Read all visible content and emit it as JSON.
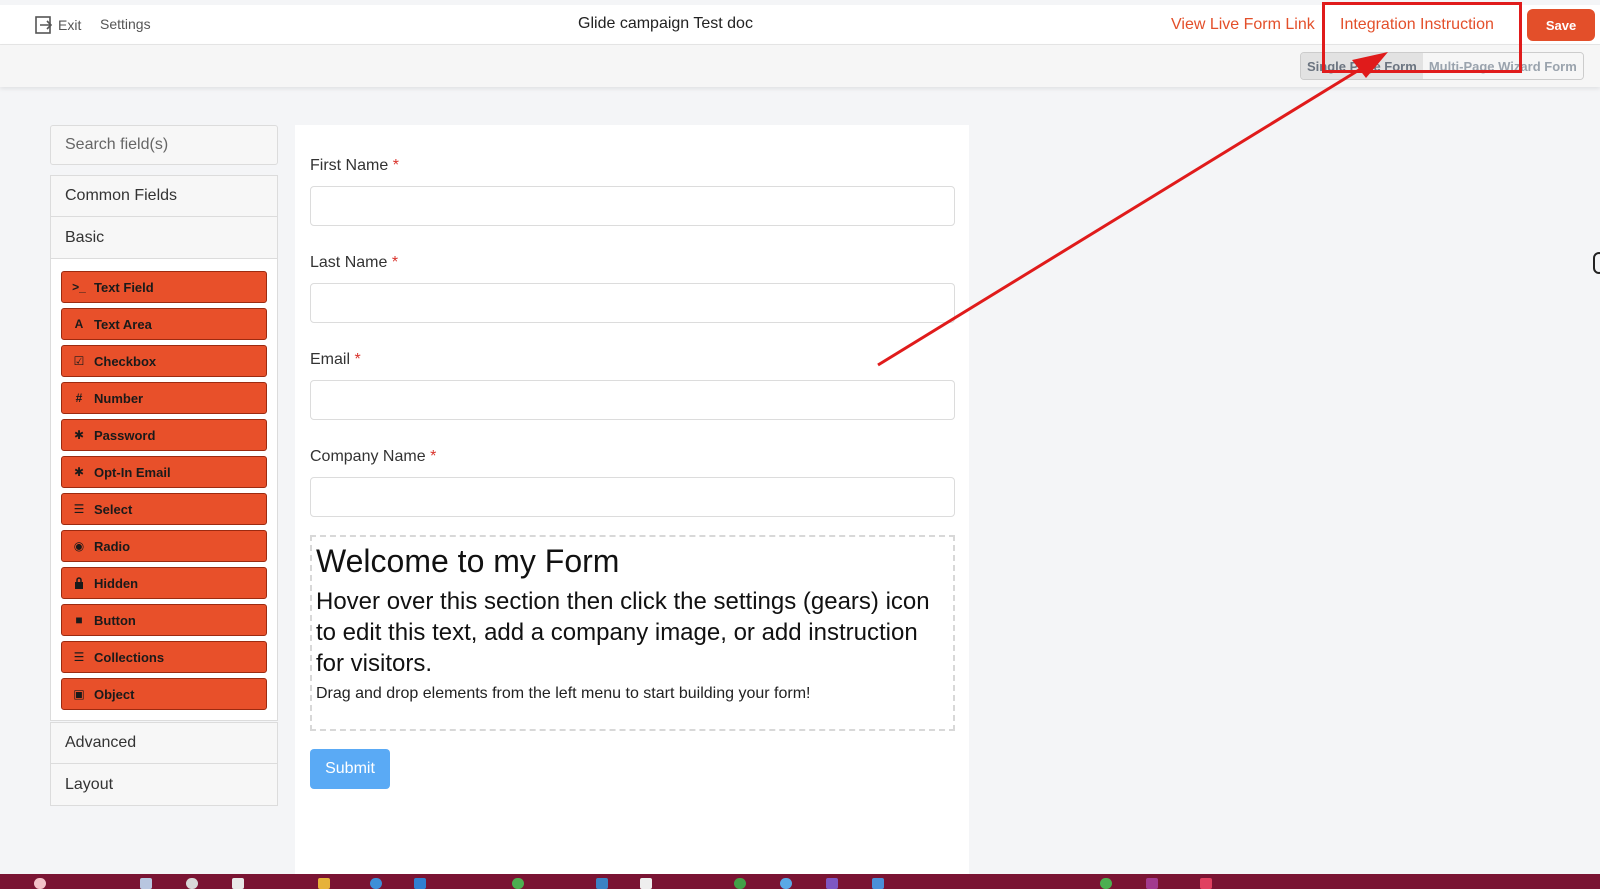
{
  "topbar": {
    "exit_label": "Exit",
    "settings_label": "Settings",
    "title": "Glide campaign Test doc",
    "live_link_label": "View Live Form Link",
    "integration_label": "Integration Instruction",
    "save_label": "Save"
  },
  "mode_toggle": {
    "options": [
      "Single Page Form",
      "Multi-Page Wizard Form"
    ],
    "selected": "Single Page Form"
  },
  "sidebar": {
    "search_placeholder": "Search field(s)",
    "sections": [
      "Common Fields",
      "Basic",
      "Advanced",
      "Layout"
    ],
    "basic_items": [
      {
        "label": "Text Field",
        "icon": "terminal-icon"
      },
      {
        "label": "Text Area",
        "icon": "font-icon"
      },
      {
        "label": "Checkbox",
        "icon": "check-square-icon"
      },
      {
        "label": "Number",
        "icon": "hash-icon"
      },
      {
        "label": "Password",
        "icon": "asterisk-icon"
      },
      {
        "label": "Opt-In Email",
        "icon": "asterisk-icon"
      },
      {
        "label": "Select",
        "icon": "list-icon"
      },
      {
        "label": "Radio",
        "icon": "dot-circle-icon"
      },
      {
        "label": "Hidden",
        "icon": "lock-icon"
      },
      {
        "label": "Button",
        "icon": "stop-icon"
      },
      {
        "label": "Collections",
        "icon": "list-icon"
      },
      {
        "label": "Object",
        "icon": "object-icon"
      }
    ]
  },
  "form": {
    "fields": [
      {
        "label": "First Name",
        "required": "*"
      },
      {
        "label": "Last Name",
        "required": "*"
      },
      {
        "label": "Email",
        "required": "*"
      },
      {
        "label": "Company Name",
        "required": "*"
      }
    ],
    "content": {
      "heading": "Welcome to my Form",
      "subheading": "Hover over this section then click the settings (gears) icon to edit this text, add a company image, or add instruction for visitors.",
      "paragraph": "Drag and drop elements from the left menu to start building your form!"
    },
    "submit_label": "Submit"
  },
  "annotation": {
    "color": "#e01b1b"
  },
  "colors": {
    "accent": "#e34f2a",
    "field_button": "#e8502a",
    "submit": "#5aaaf5",
    "taskbar": "#7a1433"
  }
}
